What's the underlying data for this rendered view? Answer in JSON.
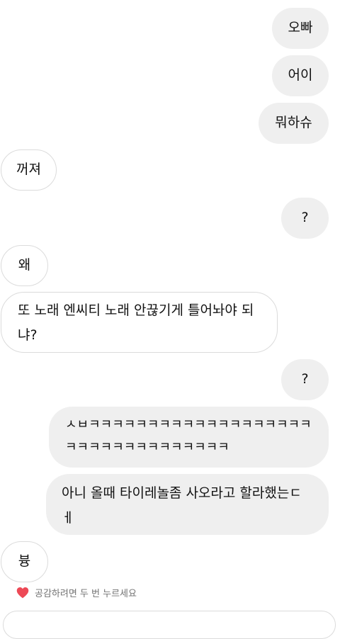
{
  "messages": [
    {
      "side": "sent",
      "text": "오빠"
    },
    {
      "side": "sent",
      "text": "어이"
    },
    {
      "side": "sent",
      "text": "뭐하슈"
    },
    {
      "side": "received",
      "text": "꺼져"
    },
    {
      "side": "sent",
      "text": "?"
    },
    {
      "side": "received",
      "text": "왜"
    },
    {
      "side": "received",
      "text": "또 노래 엔씨티 노래 안끊기게 틀어놔야 되냐?"
    },
    {
      "side": "sent",
      "text": "?"
    },
    {
      "side": "sent",
      "text": "ㅅㅂㅋㅋㅋㅋㅋㅋㅋㅋㅋㅋㅋㅋㅋㅋㅋㅋㅋㅋㅋㅋㅋㅋㅋㅋㅋㅋㅋㅋㅋㅋㅋㅋㅋ"
    },
    {
      "side": "sent",
      "text": "아니 올때 타이레놀좀 사오라고 할라했는ㄷ ㅔ"
    },
    {
      "side": "received",
      "text": "븅"
    }
  ],
  "reaction_hint": {
    "icon": "heart-icon",
    "text": "공감하려면 두 번 누르세요",
    "color": "#ed4956"
  }
}
